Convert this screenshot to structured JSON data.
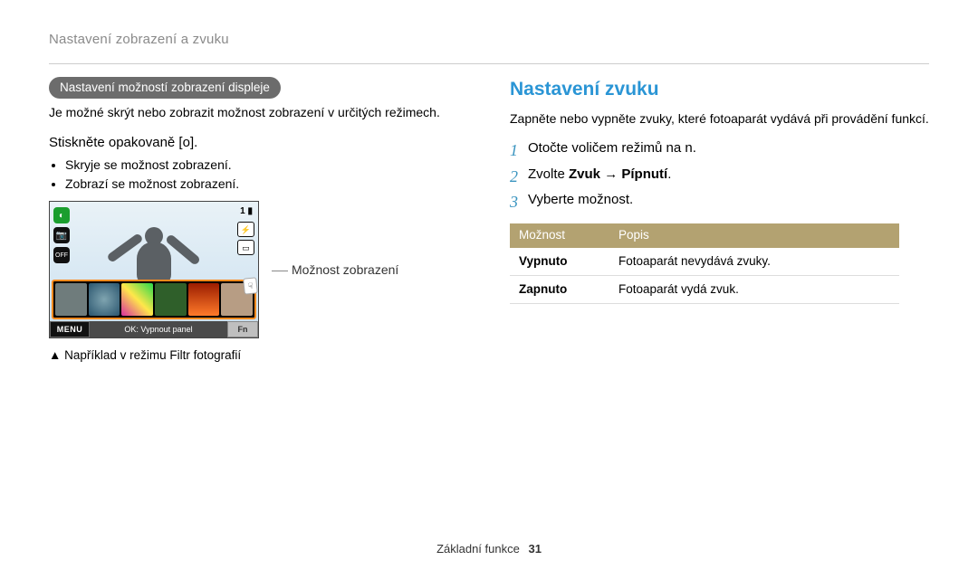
{
  "page_header": "Nastavení zobrazení a zvuku",
  "footer": {
    "section": "Základní funkce",
    "page_number": "31"
  },
  "left": {
    "pill": "Nastavení možností zobrazení displeje",
    "intro": "Je možné skrýt nebo zobrazit možnost zobrazení v určitých režimech.",
    "subhead_pre": "Stiskněte opakovaně [",
    "subhead_icon": "o",
    "subhead_post": "].",
    "bullets": [
      "Skryje se možnost zobrazení.",
      "Zobrazí se možnost zobrazení."
    ],
    "camera": {
      "top_right": "1 ▮",
      "menu": "MENU",
      "mid": "OK: Vypnout panel",
      "fn": "Fn"
    },
    "callout": "Možnost zobrazení",
    "example_note": "▲ Například v režimu Filtr fotografií"
  },
  "right": {
    "title": "Nastavení zvuku",
    "intro": "Zapněte nebo vypněte zvuky, které fotoaparát vydává při provádění funkcí.",
    "steps": [
      {
        "n": "1",
        "text_pre": "Otočte voličem režimů na ",
        "icon": "n",
        "text_post": "."
      },
      {
        "n": "2",
        "text_pre": "Zvolte ",
        "b1": "Zvuk",
        "arrow": " → ",
        "b2": "Pípnutí",
        "text_post": "."
      },
      {
        "n": "3",
        "text_pre": "Vyberte možnost.",
        "text_post": ""
      }
    ],
    "table": {
      "h1": "Možnost",
      "h2": "Popis",
      "rows": [
        {
          "k": "Vypnuto",
          "v": "Fotoaparát nevydává zvuky."
        },
        {
          "k": "Zapnuto",
          "v": "Fotoaparát vydá zvuk."
        }
      ]
    }
  }
}
